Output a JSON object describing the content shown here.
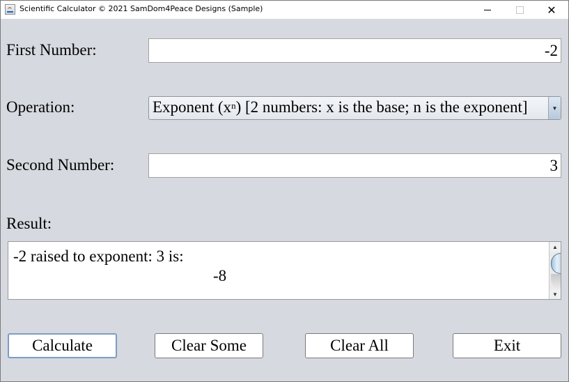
{
  "window": {
    "title": "Scientific Calculator © 2021 SamDom4Peace Designs (Sample)",
    "controls": {
      "minimize": "minimize",
      "maximize": "maximize",
      "close": "✕"
    }
  },
  "form": {
    "first_number_label": "First Number:",
    "first_number_value": "-2",
    "operation_label": "Operation:",
    "operation_selected_prefix": "Exponent (x",
    "operation_selected_sup": "n",
    "operation_selected_suffix": ") [2 numbers: x is the base; n is the exponent]",
    "second_number_label": "Second Number:",
    "second_number_value": "3",
    "result_label": "Result:",
    "result_line1": "-2 raised to exponent: 3 is:",
    "result_line2": "-8"
  },
  "buttons": {
    "calculate": "Calculate",
    "clear_some": "Clear Some",
    "clear_all": "Clear All",
    "exit": "Exit"
  },
  "icons": {
    "dropdown_arrow": "▼",
    "scroll_up": "▲",
    "scroll_down": "▼"
  }
}
